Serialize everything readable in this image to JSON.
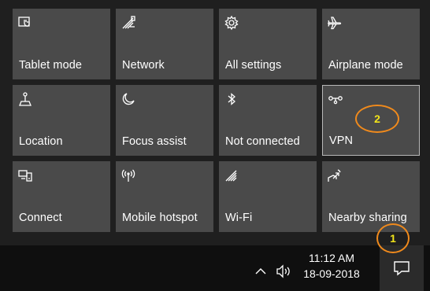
{
  "quick_actions": {
    "tiles": [
      {
        "label": "Tablet mode",
        "icon": "tablet-mode-icon"
      },
      {
        "label": "Network",
        "icon": "network-icon"
      },
      {
        "label": "All settings",
        "icon": "gear-icon"
      },
      {
        "label": "Airplane mode",
        "icon": "airplane-icon"
      },
      {
        "label": "Location",
        "icon": "location-icon"
      },
      {
        "label": "Focus assist",
        "icon": "moon-icon"
      },
      {
        "label": "Not connected",
        "icon": "bluetooth-icon"
      },
      {
        "label": "VPN",
        "icon": "vpn-icon"
      },
      {
        "label": "Connect",
        "icon": "connect-icon"
      },
      {
        "label": "Mobile hotspot",
        "icon": "hotspot-icon"
      },
      {
        "label": "Wi-Fi",
        "icon": "wifi-icon"
      },
      {
        "label": "Nearby sharing",
        "icon": "nearby-sharing-icon"
      }
    ]
  },
  "taskbar": {
    "time": "11:12 AM",
    "date": "18-09-2018"
  },
  "annotations": {
    "marker_1": "1",
    "marker_2": "2"
  },
  "colors": {
    "tile_bg": "#4a4a4a",
    "taskbar_bg": "#0f0f0f",
    "marker_ring": "#f08a1c",
    "marker_text": "#f2e41a"
  }
}
